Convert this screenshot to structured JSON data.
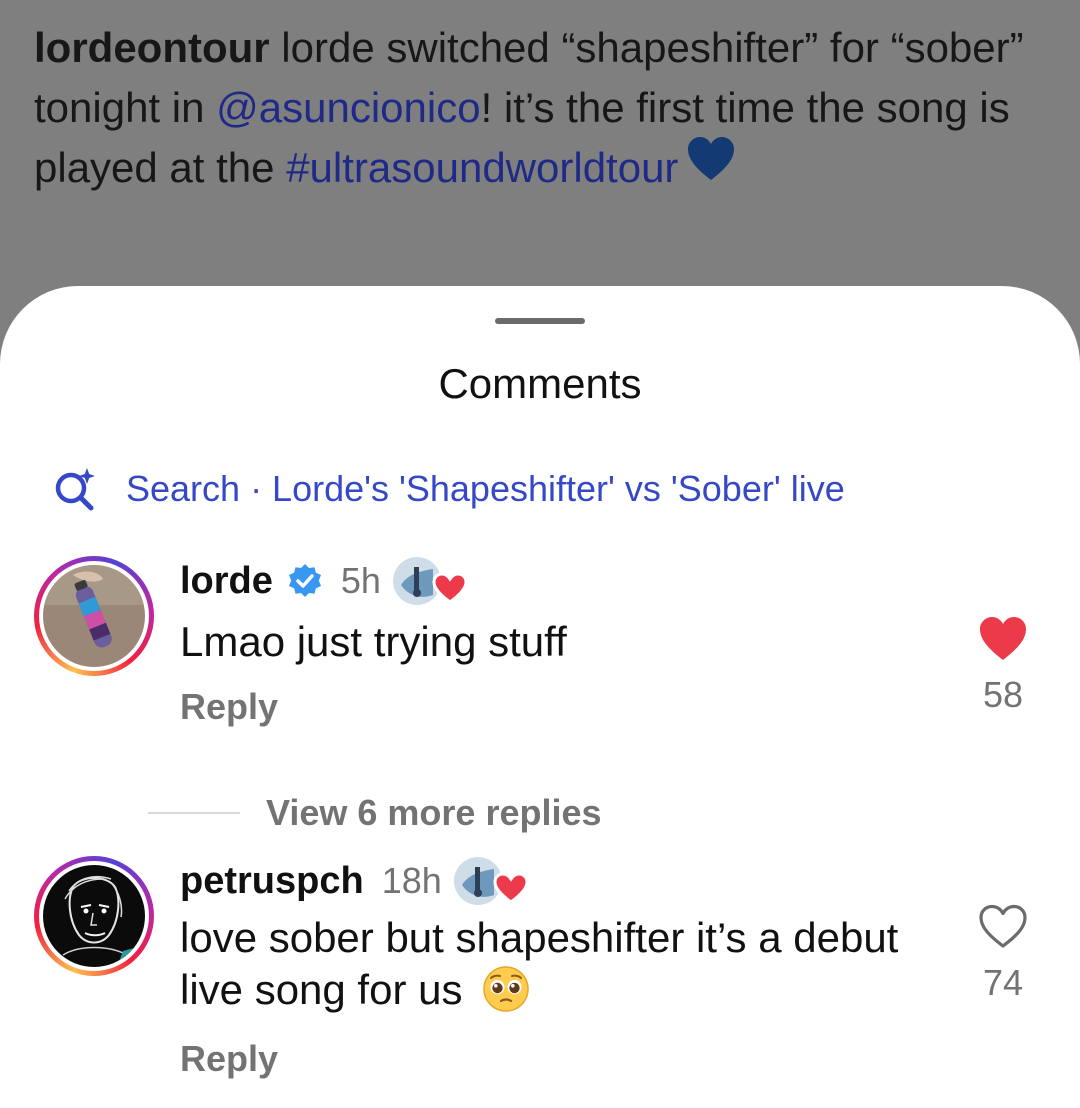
{
  "post": {
    "username": "lordeontour",
    "caption_part1": " lorde switched “shapeshifter” for “sober” tonight in ",
    "mention": "@asuncionico",
    "caption_part2": "! it’s the first time the song is played at the ",
    "hashtag": "#ultrasoundworldtour",
    "emoji": "blue-heart-icon"
  },
  "sheet": {
    "title": "Comments",
    "search_label": "Search · Lorde's 'Shapeshifter' vs 'Sober' live"
  },
  "comments": [
    {
      "username": "lorde",
      "verified": true,
      "time": "5h",
      "text": "Lmao just trying stuff",
      "reply_label": "Reply",
      "liked": true,
      "like_count": "58",
      "view_replies_label": "View 6 more replies"
    },
    {
      "username": "petruspch",
      "verified": false,
      "time": "18h",
      "text": "love sober but shapeshifter it’s a debut live song for us",
      "text_emoji": "pleading-face-icon",
      "reply_label": "Reply",
      "liked": false,
      "like_count": "74"
    }
  ],
  "colors": {
    "link": "#1f2a86",
    "search_accent": "#3548c7",
    "like_red": "#ed3a4a",
    "verified_blue": "#3897f0"
  }
}
